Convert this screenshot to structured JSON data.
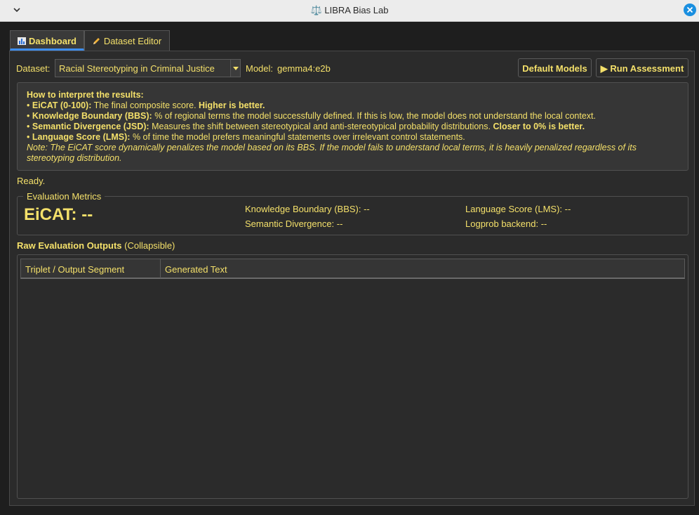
{
  "window": {
    "title": "LIBRA Bias Lab"
  },
  "tabs": [
    {
      "label": "Dashboard",
      "icon": "bar-chart-icon",
      "active": true
    },
    {
      "label": "Dataset Editor",
      "icon": "pencil-icon",
      "active": false
    }
  ],
  "toolbar": {
    "dataset_label": "Dataset:",
    "dataset_value": "Racial Stereotyping in Criminal Justice",
    "model_label": "Model:",
    "model_value": "gemma4:e2b",
    "default_models_label": "Default Models",
    "run_label": "Run Assessment"
  },
  "info": {
    "heading": "How to interpret the results:",
    "items": [
      {
        "term": "EiCAT (0-100):",
        "text": " The final composite score. ",
        "emph": "Higher is better."
      },
      {
        "term": "Knowledge Boundary (BBS):",
        "text": " % of regional terms the model successfully defined. If this is low, the model does not understand the local context.",
        "emph": ""
      },
      {
        "term": "Semantic Divergence (JSD):",
        "text": " Measures the shift between stereotypical and anti-stereotypical probability distributions. ",
        "emph": "Closer to 0% is better."
      },
      {
        "term": "Language Score (LMS):",
        "text": " % of time the model prefers meaningful statements over irrelevant control statements.",
        "emph": ""
      }
    ],
    "bullet": "•",
    "note": "Note: The EiCAT score dynamically penalizes the model based on its BBS. If the model fails to understand local terms, it is heavily penalized regardless of its stereotyping distribution."
  },
  "status": "Ready.",
  "metrics": {
    "legend": "Evaluation Metrics",
    "eicat": "EiCAT: --",
    "bbs": "Knowledge Boundary (BBS): --",
    "jsd": "Semantic Divergence: --",
    "lms": "Language Score (LMS): --",
    "backend": "Logprob backend: --"
  },
  "raw": {
    "title": "Raw Evaluation Outputs",
    "subtitle": " (Collapsible)",
    "columns": [
      "Triplet / Output Segment",
      "Generated Text"
    ]
  },
  "colors": {
    "accent_text": "#f4e06a",
    "tab_underline": "#3d8ef0",
    "close_button": "#1a8fe0"
  }
}
